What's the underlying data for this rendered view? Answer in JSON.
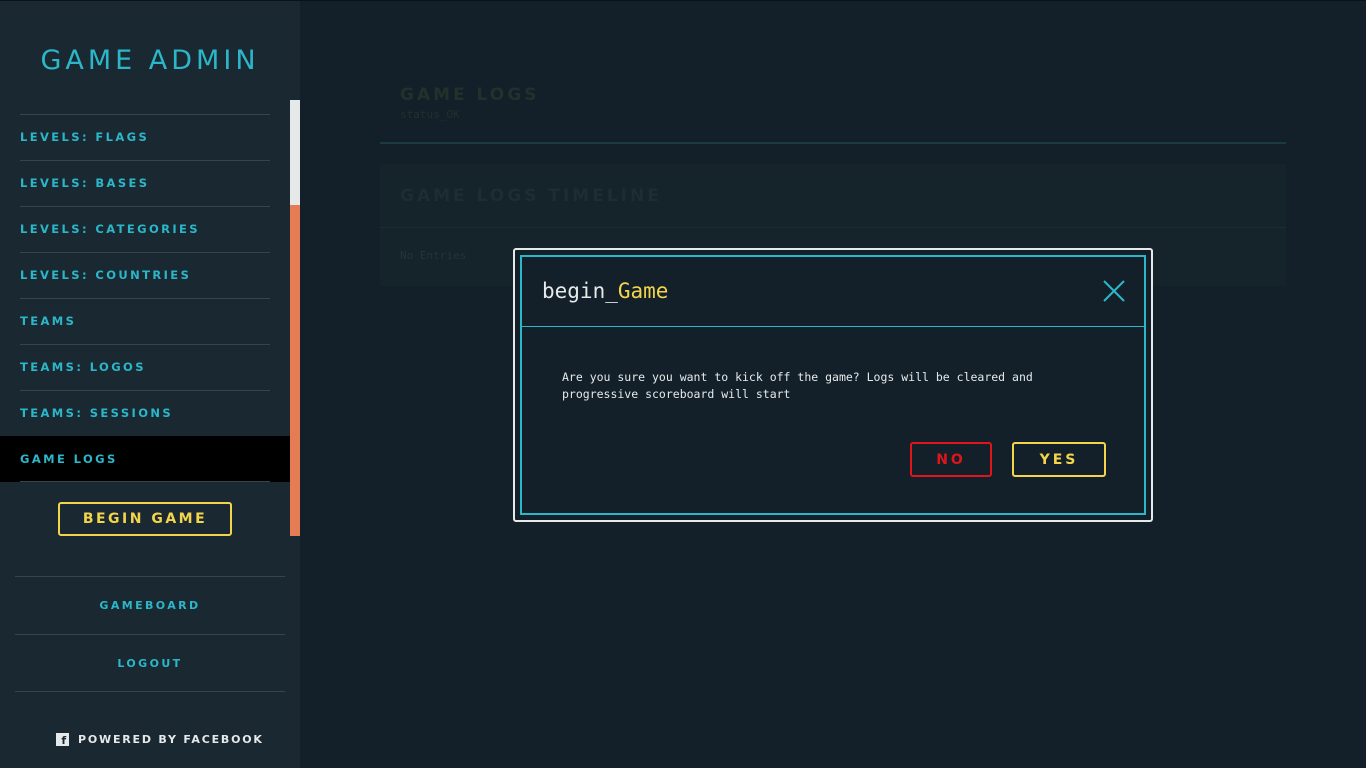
{
  "sidebar": {
    "brand": "GAME ADMIN",
    "items": [
      {
        "label": "LEVELS: FLAGS"
      },
      {
        "label": "LEVELS: BASES"
      },
      {
        "label": "LEVELS: CATEGORIES"
      },
      {
        "label": "LEVELS: COUNTRIES"
      },
      {
        "label": "TEAMS"
      },
      {
        "label": "TEAMS: LOGOS"
      },
      {
        "label": "TEAMS: SESSIONS"
      },
      {
        "label": "GAME LOGS",
        "active": true
      }
    ],
    "begin_game_label": "BEGIN GAME",
    "bottom_items": [
      {
        "label": "GAMEBOARD"
      },
      {
        "label": "LOGOUT"
      }
    ],
    "powered_by": "POWERED BY FACEBOOK",
    "powered_icon": "facebook-icon"
  },
  "main": {
    "title": "GAME LOGS",
    "status": "status_OK",
    "timeline_title": "GAME LOGS TIMELINE",
    "timeline_empty": "No Entries"
  },
  "modal": {
    "title_prefix": "begin_",
    "title_suffix": "Game",
    "message": "Are you sure you want to kick off the game? Logs will be cleared and progressive scoreboard will start",
    "no_label": "NO",
    "yes_label": "YES",
    "close_icon": "close-icon"
  },
  "colors": {
    "accent": "#2bb7c9",
    "highlight": "#f2d54a",
    "danger": "#e0141b",
    "scroll": "#e57c54",
    "background": "#13202a"
  }
}
